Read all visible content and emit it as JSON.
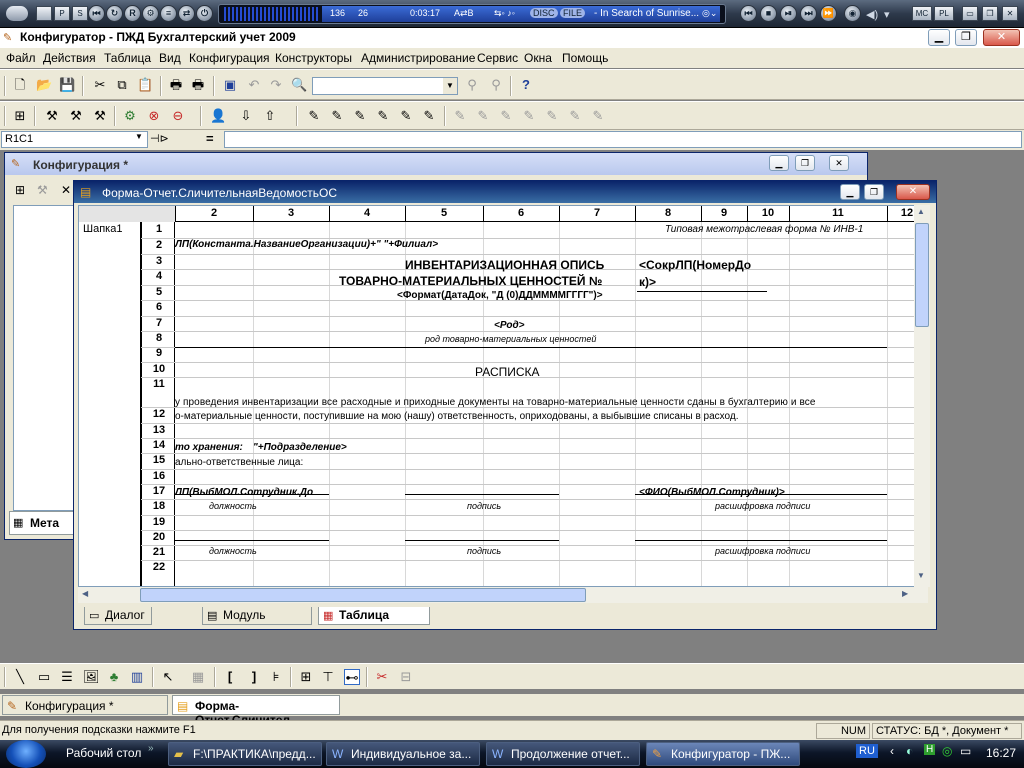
{
  "media_player": {
    "left_buttons": [
      "P",
      "S"
    ],
    "readout": {
      "a": "136",
      "b": "26",
      "time": "0:03:17",
      "mode": "A⇄B",
      "disc": "DISC",
      "file": "FILE",
      "track": "- In Search of Sunrise..."
    },
    "right_buttons": [
      "MC",
      "PL"
    ]
  },
  "app": {
    "title": "Конфигуратор - ПЖД Бухгалтерский учет 2009",
    "menu": [
      "Файл",
      "Действия",
      "Таблица",
      "Вид",
      "Конфигурация",
      "Конструкторы",
      "Администрирование",
      "Сервис",
      "Окна",
      "Помощь"
    ]
  },
  "formula_bar": {
    "cell_ref": "R1C1",
    "equals": "="
  },
  "config_window": {
    "title": "Конфигурация *",
    "tab_label": "Мета"
  },
  "form_window": {
    "title": "Форма-Отчет.СличительнаяВедомостьОС",
    "columns": [
      "2",
      "3",
      "4",
      "5",
      "6",
      "7",
      "8",
      "9",
      "10",
      "11",
      "12"
    ],
    "section_label": "Шапка1",
    "rows": [
      "1",
      "2",
      "3",
      "4",
      "5",
      "6",
      "7",
      "8",
      "9",
      "10",
      "11",
      "12",
      "13",
      "14",
      "15",
      "16",
      "17",
      "18",
      "19",
      "20",
      "21",
      "22"
    ],
    "cells": {
      "r1": "Типовая межотраслевая форма № ИНВ-1",
      "r2": "ЛП(Константа.НазваниеОрганизации)+\" \"+Филиал>",
      "r3": "ИНВЕНТАРИЗАЦИОННАЯ ОПИСЬ",
      "r3b": "<СокрЛП(НомерДо",
      "r4": "ТОВАРНО-МАТЕРИАЛЬНЫХ ЦЕННОСТЕЙ  №",
      "r4b": "к)>",
      "r5": "<Формат(ДатаДок, \"Д (0)ДДММММГГГГ\")>",
      "r7": "<Род>",
      "r8": "род товарно-материальных ценностей",
      "r10": "РАСПИСКА",
      "r11": "у проведения инвентаризации все расходные и приходные документы на товарно-материальные ценности сданы в бухгалтерию и все",
      "r12": "о-материальные ценности, поступившие на мою (нашу) ответственность, оприходованы, а выбывшие списаны в расход.",
      "r14a": "то хранения:",
      "r14b": "\"+Подразделение>",
      "r15": "ально-ответственные лица:",
      "r17a": "ЛП(ВыбМОЛ.Сотрудник.До",
      "r17b": "<ФИО(ВыбМОЛ.Сотрудник)>",
      "r18a": "должность",
      "r18b": "подпись",
      "r18c": "расшифровка подписи",
      "r21a": "должность",
      "r21b": "подпись",
      "r21c": "расшифровка подписи"
    },
    "tabs": [
      "Диалог",
      "Модуль",
      "Таблица"
    ],
    "active_tab": "Таблица"
  },
  "window_bar": [
    "Конфигурация *",
    "Форма-Отчет.Сличител..."
  ],
  "status": {
    "hint": "Для получения подсказки нажмите F1",
    "num": "NUM",
    "state": "СТАТУС: БД *, Документ *"
  },
  "taskbar": {
    "desktop": "Рабочий стол",
    "tasks": [
      "F:\\ПРАКТИКА\\предд...",
      "Индивидуальное за...",
      "Продолжение отчет...",
      "Конфигуратор - ПЖ..."
    ],
    "lang": "RU",
    "clock": "16:27"
  },
  "colors": {
    "form_title_bg": "#0a246a",
    "chrome": "#ece9d8",
    "close": "#d9584a"
  }
}
